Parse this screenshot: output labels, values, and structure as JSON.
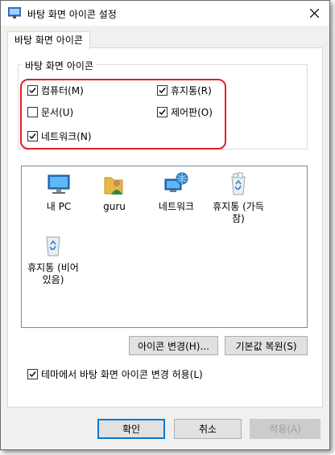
{
  "window": {
    "title": "바탕 화면 아이콘 설정"
  },
  "tabs": [
    {
      "label": "바탕 화면 아이콘"
    }
  ],
  "group": {
    "label": "바탕 화면 아이콘",
    "checkboxes": [
      {
        "label": "컴퓨터(M)",
        "checked": true
      },
      {
        "label": "휴지통(R)",
        "checked": true
      },
      {
        "label": "문서(U)",
        "checked": false
      },
      {
        "label": "제어판(O)",
        "checked": true
      },
      {
        "label": "네트워크(N)",
        "checked": true
      }
    ]
  },
  "icons": [
    {
      "label": "내 PC",
      "icon": "computer-icon"
    },
    {
      "label": "guru",
      "icon": "user-folder-icon"
    },
    {
      "label": "네트워크",
      "icon": "network-icon"
    },
    {
      "label": "휴지통 (가득\n참)",
      "icon": "recycle-bin-full-icon"
    },
    {
      "label": "휴지통 (비어\n있음)",
      "icon": "recycle-bin-empty-icon"
    }
  ],
  "buttons": {
    "change_icon": "아이콘 변경(H)...",
    "restore_default": "기본값 복원(S)",
    "ok": "확인",
    "cancel": "취소",
    "apply": "적용(A)"
  },
  "theme_checkbox": {
    "label": "테마에서 바탕 화면 아이콘 변경 허용(L)",
    "checked": true
  },
  "colors": {
    "highlight": "#e0202a",
    "accent": "#0078d7"
  }
}
